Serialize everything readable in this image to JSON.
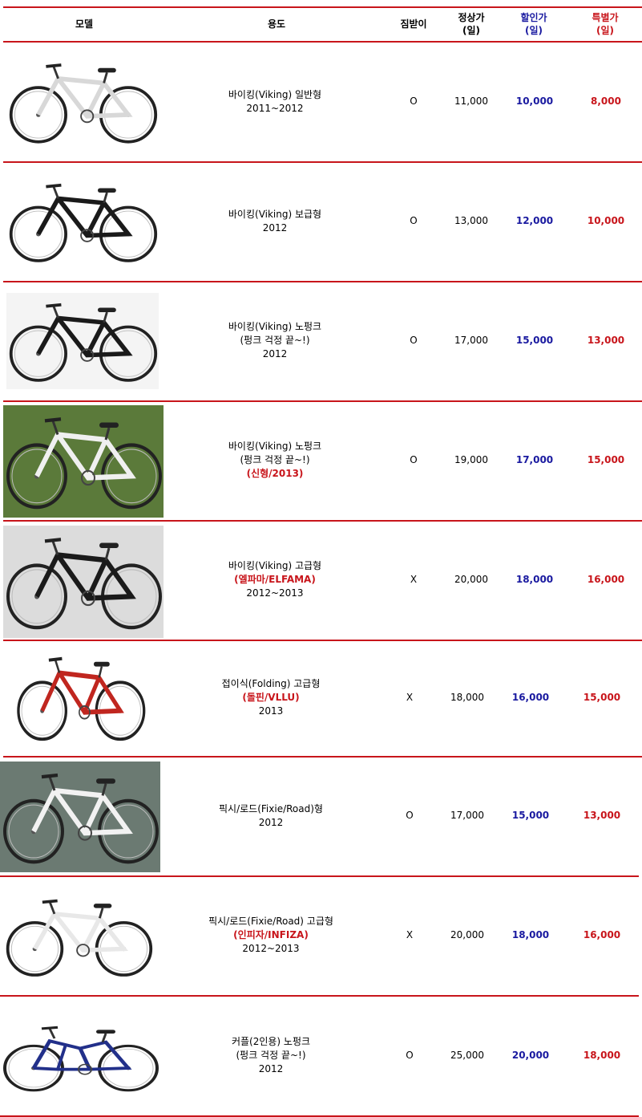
{
  "header": {
    "model": "모델",
    "usage": "용도",
    "kickstand": "짐받이",
    "regular": "정상가",
    "discount": "할인가",
    "special": "특별가",
    "unit": "(일)"
  },
  "rows": [
    {
      "usage": [
        "바이킹(Viking) 일반형",
        "2011~2012"
      ],
      "usage_red": null,
      "kickstand": "O",
      "regular": "11,000",
      "discount": "10,000",
      "special": "8,000",
      "frame": "#d8d8d8",
      "bg": "#ffffff"
    },
    {
      "usage": [
        "바이킹(Viking) 보급형",
        "2012"
      ],
      "usage_red": null,
      "kickstand": "O",
      "regular": "13,000",
      "discount": "12,000",
      "special": "10,000",
      "frame": "#1a1a1a",
      "bg": "#ffffff"
    },
    {
      "usage": [
        "바이킹(Viking) 노펑크",
        "(펑크 걱정 끝~!)",
        "2012"
      ],
      "usage_red": null,
      "kickstand": "O",
      "regular": "17,000",
      "discount": "15,000",
      "special": "13,000",
      "frame": "#1a1a1a",
      "bg": "#f4f4f4"
    },
    {
      "usage": [
        "바이킹(Viking) 노펑크",
        "(펑크 걱정 끝~!)"
      ],
      "usage_red": "(신형/2013)",
      "kickstand": "O",
      "regular": "19,000",
      "discount": "17,000",
      "special": "15,000",
      "frame": "#f0f0f0",
      "bg": "#5b7a3a"
    },
    {
      "usage": [
        "바이킹(Viking) 고급형"
      ],
      "usage_red": "(엘파마/ELFAMA)",
      "usage_after": "2012~2013",
      "kickstand": "X",
      "regular": "20,000",
      "discount": "18,000",
      "special": "16,000",
      "frame": "#1a1a1a",
      "bg": "#dcdcdc"
    },
    {
      "usage": [
        "접이식(Folding) 고급형"
      ],
      "usage_red": "(돌핀/VLLU)",
      "usage_after": "2013",
      "kickstand": "X",
      "regular": "18,000",
      "discount": "16,000",
      "special": "15,000",
      "frame": "#c0261f",
      "bg": "#ffffff"
    },
    {
      "usage": [
        "픽시/로드(Fixie/Road)형",
        "2012"
      ],
      "usage_red": null,
      "kickstand": "O",
      "regular": "17,000",
      "discount": "15,000",
      "special": "13,000",
      "frame": "#f2f2f2",
      "bg": "#6b7a72"
    },
    {
      "usage": [
        "픽시/로드(Fixie/Road) 고급형"
      ],
      "usage_red": "(인피자/INFIZA)",
      "usage_after": "2012~2013",
      "kickstand": "X",
      "regular": "20,000",
      "discount": "18,000",
      "special": "16,000",
      "frame": "#e8e8e8",
      "bg": "#ffffff"
    },
    {
      "usage": [
        "커플(2인용) 노펑크",
        "(펑크 걱정 끝~!)",
        "2012"
      ],
      "usage_red": null,
      "kickstand": "O",
      "regular": "25,000",
      "discount": "20,000",
      "special": "18,000",
      "frame": "#22308a",
      "bg": "#ffffff"
    }
  ]
}
